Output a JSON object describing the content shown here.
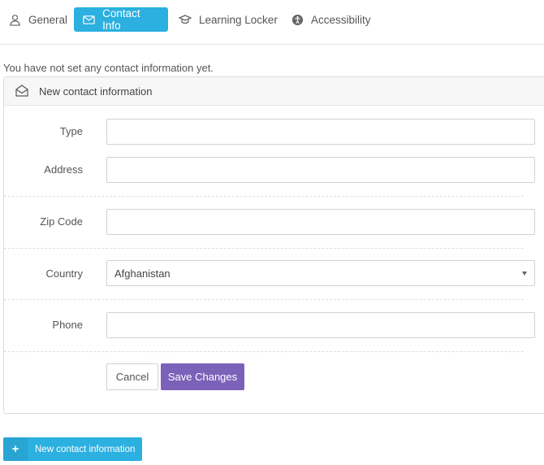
{
  "tabs": [
    {
      "label": "General",
      "icon": "user-icon",
      "active": false
    },
    {
      "label": "Contact Info",
      "icon": "envelope-icon",
      "active": true
    },
    {
      "label": "Learning Locker",
      "icon": "graduation-cap-icon",
      "active": false
    },
    {
      "label": "Accessibility",
      "icon": "accessibility-icon",
      "active": false
    }
  ],
  "notice": "You have not set any contact information yet.",
  "panel": {
    "title": "New contact information",
    "fields": {
      "type": {
        "label": "Type",
        "value": ""
      },
      "address": {
        "label": "Address",
        "value": ""
      },
      "zip": {
        "label": "Zip Code",
        "value": ""
      },
      "country": {
        "label": "Country",
        "value": "Afghanistan"
      },
      "phone": {
        "label": "Phone",
        "value": ""
      }
    },
    "cancel_label": "Cancel",
    "save_label": "Save Changes"
  },
  "new_button_label": "New contact information",
  "colors": {
    "accent": "#2bb0e0",
    "save": "#7b62b8"
  }
}
